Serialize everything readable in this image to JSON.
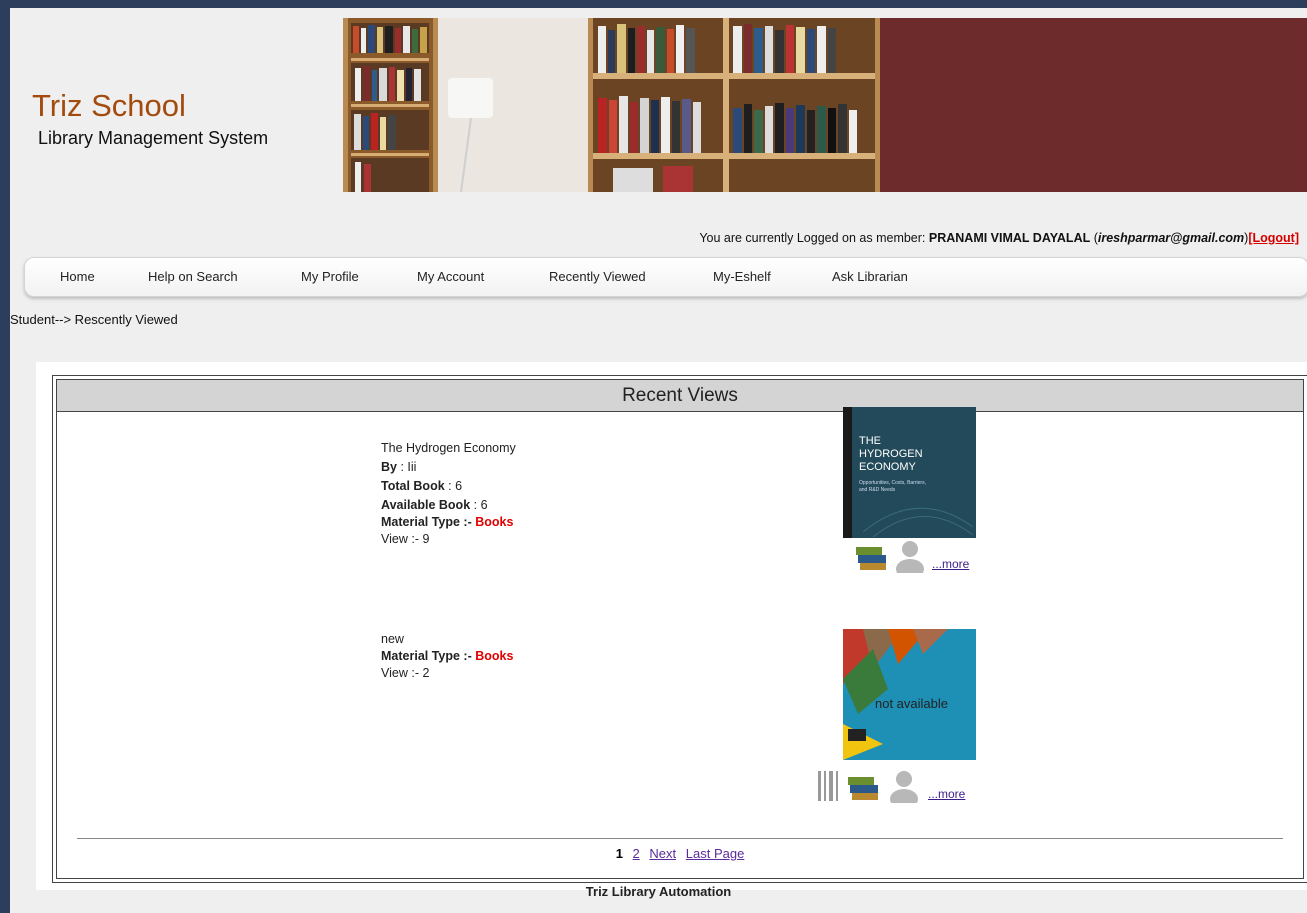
{
  "header": {
    "school_name": "Triz School",
    "subtitle": "Library Management System",
    "banner_color": "#6d2b2c"
  },
  "login": {
    "prefix": "You are currently Logged on as member: ",
    "member_name": "PRANAMI VIMAL DAYALAL",
    "email": "ireshparmar@gmail.com",
    "logout_label": "[Logout]"
  },
  "nav": {
    "items": [
      {
        "label": "Home"
      },
      {
        "label": "Help on Search"
      },
      {
        "label": "My Profile"
      },
      {
        "label": "My Account"
      },
      {
        "label": "Recently Viewed"
      },
      {
        "label": "My-Eshelf"
      },
      {
        "label": "Ask Librarian"
      }
    ]
  },
  "breadcrumb": "Student--> Rescently Viewed",
  "section_title": "Recent Views",
  "items": [
    {
      "title": "The Hydrogen Economy",
      "by_label": "By",
      "by_value": " : Iii",
      "total_label": "Total Book",
      "total_value": " : 6",
      "available_label": "Available Book",
      "available_value": " : 6",
      "material_label": "Material Type :- ",
      "material_value": "Books",
      "views": "View :- 9",
      "cover_line1": "THE",
      "cover_line2": "HYDROGEN",
      "cover_line3": "ECONOMY",
      "cover_line4": "Opportunities, Costs, Barriers, and R&D Needs",
      "more_label": "...more"
    },
    {
      "title": "new",
      "material_label": "Material Type :- ",
      "material_value": "Books",
      "views": "View :- 2",
      "cover_text": "not available",
      "more_label": "...more"
    }
  ],
  "pager": {
    "current": "1",
    "page2": "2",
    "next": "Next",
    "last": "Last Page"
  },
  "footer": "Triz Library Automation"
}
